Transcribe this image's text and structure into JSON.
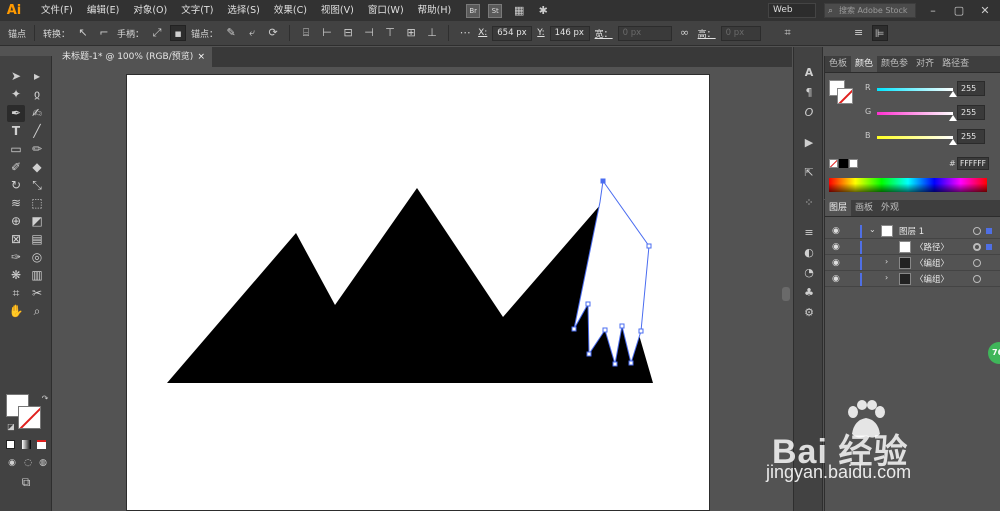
{
  "app": {
    "logo": "Ai"
  },
  "menu": [
    "文件(F)",
    "编辑(E)",
    "对象(O)",
    "文字(T)",
    "选择(S)",
    "效果(C)",
    "视图(V)",
    "窗口(W)",
    "帮助(H)"
  ],
  "bridge_badges": [
    "Br",
    "St"
  ],
  "workspace": "Web",
  "stock_search": {
    "placeholder": "搜索 Adobe Stock"
  },
  "control_bar": {
    "anchor_label": "锚点",
    "convert_label": "转换：",
    "handles_label": "手柄：",
    "anchor_points_label": "锚点：",
    "x_label": "X:",
    "x_value": "654 px",
    "y_label": "Y:",
    "y_value": "146 px",
    "w_label": "宽：",
    "w_value": "0 px",
    "h_label": "高：",
    "h_value": "0 px"
  },
  "document_tab": {
    "title": "未标题-1* @ 100% (RGB/预览)",
    "close": "×"
  },
  "color_panel": {
    "tabs": [
      "色板",
      "颜色",
      "颜色参",
      "对齐",
      "路径查"
    ],
    "active_tab": 1,
    "channels": [
      {
        "label": "R",
        "value": "255",
        "color": "#00e5ff"
      },
      {
        "label": "G",
        "value": "255",
        "color": "#ff2fd0"
      },
      {
        "label": "B",
        "value": "255",
        "color": "#ffff20"
      }
    ],
    "hex_label": "#",
    "hex_value": "FFFFFF"
  },
  "layers_panel": {
    "tabs": [
      "图层",
      "画板",
      "外观"
    ],
    "active_tab": 0,
    "rows": [
      {
        "name": "图层 1",
        "expanded": true,
        "indent": 0
      },
      {
        "name": "〈路径〉",
        "expanded": false,
        "indent": 1
      },
      {
        "name": "〈编组〉",
        "expanded": false,
        "indent": 1
      },
      {
        "name": "〈编组〉",
        "expanded": false,
        "indent": 1
      }
    ]
  },
  "watermark": {
    "brand": "Bai  经验",
    "url": "jingyan.baidu.com"
  },
  "badge": "76"
}
